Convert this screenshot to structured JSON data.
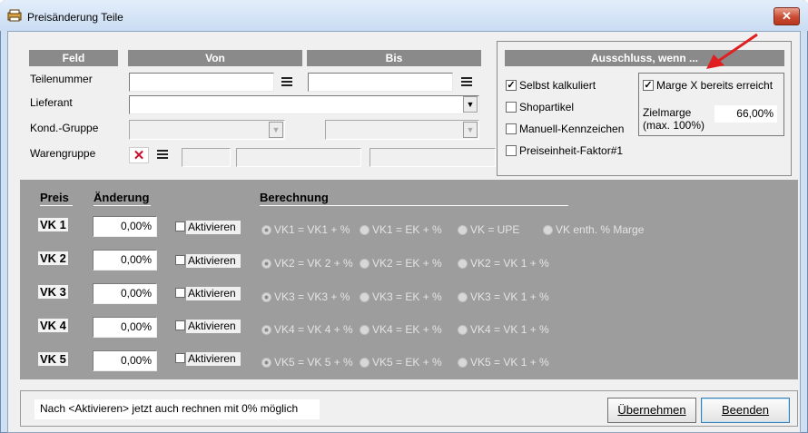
{
  "window": {
    "title": "Preisänderung Teile",
    "close_symbol": "✕"
  },
  "filter": {
    "headers": {
      "feld": "Feld",
      "von": "Von",
      "bis": "Bis"
    },
    "rows": {
      "teilenummer": "Teilenummer",
      "lieferant": "Lieferant",
      "kond_gruppe": "Kond.-Gruppe",
      "warengruppe": "Warengruppe"
    },
    "clear_symbol": "✕",
    "dropdown_symbol": "▼"
  },
  "exclusion": {
    "header": "Ausschluss, wenn ...",
    "options": [
      {
        "label": "Selbst kalkuliert",
        "checked": true
      },
      {
        "label": "Shopartikel",
        "checked": false
      },
      {
        "label": "Manuell-Kennzeichen",
        "checked": false
      },
      {
        "label": "Preiseinheit-Faktor#1",
        "checked": false
      }
    ],
    "marge_label": "Marge X bereits erreicht",
    "marge_checked": true,
    "zielmarge_label": "Zielmarge",
    "zielmarge_hint": "(max. 100%)",
    "zielmarge_value": "66,00%"
  },
  "pricing": {
    "headers": {
      "preis": "Preis",
      "aenderung": "Änderung",
      "berechnung": "Berechnung"
    },
    "activate_label": "Aktivieren",
    "rows": [
      {
        "label": "VK 1",
        "value": "0,00%",
        "options": [
          "VK1 = VK1 + %",
          "VK1 = EK + %",
          "VK = UPE",
          "VK enth. % Marge"
        ]
      },
      {
        "label": "VK 2",
        "value": "0,00%",
        "options": [
          "VK2 = VK 2 + %",
          "VK2 = EK + %",
          "VK2 = VK 1 + %"
        ]
      },
      {
        "label": "VK 3",
        "value": "0,00%",
        "options": [
          "VK3 = VK3 + %",
          "VK3 = EK + %",
          "VK3  = VK 1 + %"
        ]
      },
      {
        "label": "VK 4",
        "value": "0,00%",
        "options": [
          "VK4 = VK 4 + %",
          "VK4 = EK + %",
          "VK4 = VK 1 + %"
        ]
      },
      {
        "label": "VK 5",
        "value": "0,00%",
        "options": [
          "VK5 = VK 5 + %",
          "VK5 = EK + %",
          "VK5 = VK 1 + %"
        ]
      }
    ]
  },
  "footer": {
    "note": "Nach <Aktivieren> jetzt auch rechnen mit 0% möglich",
    "apply_button": "Übernehmen",
    "close_button": "Beenden"
  },
  "colors": {
    "panel_gray": "#9d9d9d",
    "header_gray": "#8a8a8a",
    "annotation_arrow": "#e02020"
  }
}
